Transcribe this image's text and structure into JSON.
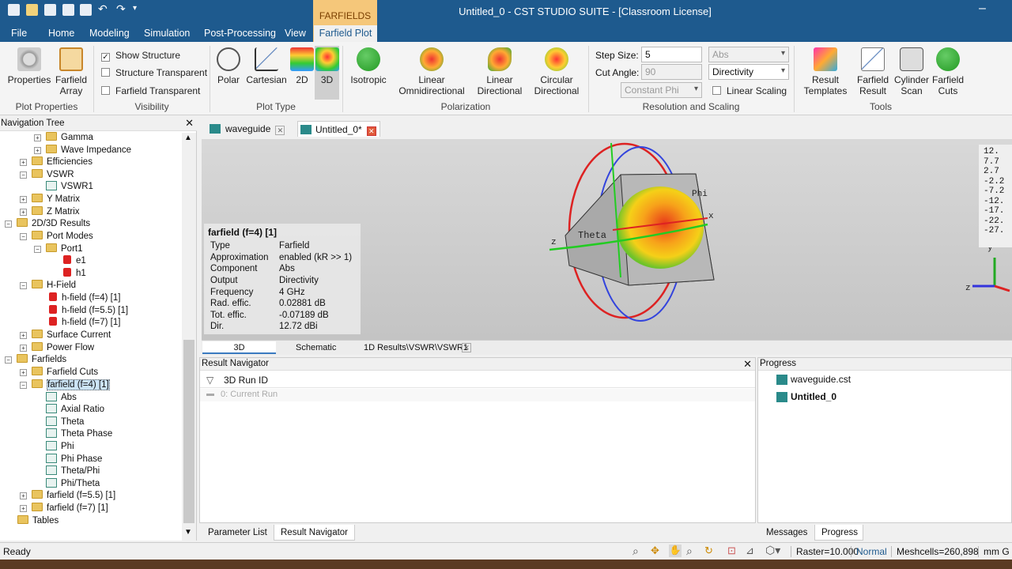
{
  "window": {
    "title": "Untitled_0 - CST STUDIO SUITE - [Classroom License]",
    "context_tab": "FARFIELDS"
  },
  "menu": {
    "file": "File",
    "tabs": [
      "Home",
      "Modeling",
      "Simulation",
      "Post-Processing",
      "View"
    ],
    "active_tab": "Farfield Plot"
  },
  "ribbon": {
    "plot_properties": {
      "properties": "Properties",
      "farfield_array": [
        "Farfield",
        "Array"
      ],
      "group": "Plot Properties"
    },
    "visibility": {
      "show_structure": "Show Structure",
      "show_structure_checked": true,
      "structure_transparent": "Structure Transparent",
      "farfield_transparent": "Farfield Transparent",
      "group": "Visibility"
    },
    "plot_type": {
      "polar": "Polar",
      "cartesian": "Cartesian",
      "2d": "2D",
      "3d": "3D",
      "group": "Plot Type"
    },
    "polarization": {
      "isotropic": "Isotropic",
      "linear_omni": [
        "Linear",
        "Omnidirectional"
      ],
      "linear_dir": [
        "Linear",
        "Directional"
      ],
      "circular_dir": [
        "Circular",
        "Directional"
      ],
      "group": "Polarization"
    },
    "resolution": {
      "step_size_label": "Step Size:",
      "step_size": "5",
      "cut_angle_label": "Cut Angle:",
      "cut_angle": "90",
      "constant": "Constant Phi",
      "component": "Abs",
      "output": "Directivity",
      "linear_scaling": "Linear Scaling",
      "group": "Resolution and Scaling"
    },
    "tools": {
      "result_templates": [
        "Result",
        "Templates"
      ],
      "farfield_result": [
        "Farfield",
        "Result"
      ],
      "cylinder_scan": [
        "Cylinder",
        "Scan"
      ],
      "farfield_cuts": [
        "Farfield",
        "Cuts"
      ],
      "group": "Tools"
    }
  },
  "nav_tree": {
    "title": "Navigation Tree",
    "items": [
      "Gamma",
      "Wave Impedance",
      "Efficiencies",
      "VSWR",
      "VSWR1",
      "Y Matrix",
      "Z Matrix",
      "2D/3D Results",
      "Port Modes",
      "Port1",
      "e1",
      "h1",
      "H-Field",
      "h-field (f=4) [1]",
      "h-field (f=5.5) [1]",
      "h-field (f=7) [1]",
      "Surface Current",
      "Power Flow",
      "Farfields",
      "Farfield Cuts",
      "farfield (f=4) [1]",
      "Abs",
      "Axial Ratio",
      "Theta",
      "Theta Phase",
      "Phi",
      "Phi Phase",
      "Theta/Phi",
      "Phi/Theta",
      "farfield (f=5.5) [1]",
      "farfield (f=7) [1]",
      "Tables"
    ]
  },
  "doc_tabs": [
    "waveguide",
    "Untitled_0*"
  ],
  "farfield_info": {
    "title": "farfield (f=4) [1]",
    "rows": [
      {
        "k": "Type",
        "v": "Farfield"
      },
      {
        "k": "Approximation",
        "v": "enabled (kR >> 1)"
      },
      {
        "k": "Component",
        "v": "Abs"
      },
      {
        "k": "Output",
        "v": "Directivity"
      },
      {
        "k": "Frequency",
        "v": "4 GHz"
      },
      {
        "k": "Rad. effic.",
        "v": "0.02881 dB"
      },
      {
        "k": "Tot. effic.",
        "v": "-0.07189 dB"
      },
      {
        "k": "Dir.",
        "v": "12.72 dBi"
      }
    ]
  },
  "legend": [
    "12.",
    "7.7",
    "2.7",
    "-2.2",
    "-7.2",
    "-12.",
    "-17.",
    "-22.",
    "-27."
  ],
  "axis_labels": {
    "phi": "Phi",
    "theta": "Theta",
    "x": "x",
    "y": "y",
    "z": "z"
  },
  "view_tabs": [
    "3D",
    "Schematic",
    "1D Results\\VSWR\\VSWR1"
  ],
  "result_navigator": {
    "title": "Result Navigator",
    "col": "3D Run ID",
    "row": "0: Current Run"
  },
  "progress": {
    "title": "Progress",
    "items": [
      "waveguide.cst",
      "Untitled_0"
    ]
  },
  "bottom_tabs": {
    "left": [
      "Parameter List",
      "Result Navigator"
    ],
    "right": [
      "Messages",
      "Progress"
    ]
  },
  "status": {
    "ready": "Ready",
    "raster": "Raster=10.000",
    "mode": "Normal",
    "meshcells": "Meshcells=260,898",
    "units": "mm G"
  }
}
